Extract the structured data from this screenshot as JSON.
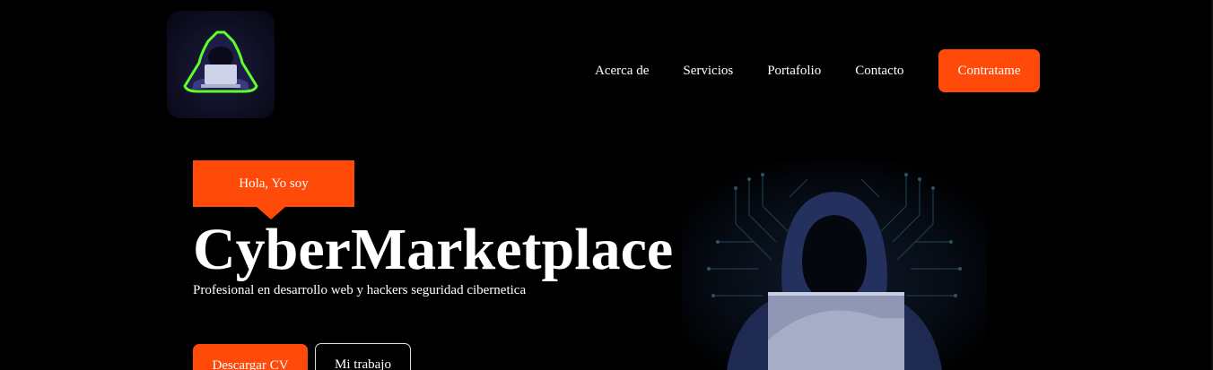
{
  "brand": {
    "logo_icon": "hooded-hacker-laptop-icon"
  },
  "nav": {
    "items": [
      "Acerca de",
      "Servicios",
      "Portafolio",
      "Contacto"
    ],
    "cta_label": "Contratame"
  },
  "hero": {
    "greeting": "Hola, Yo soy",
    "title": "CyberMarketplace",
    "subtitle": "Profesional en desarrollo web y hackers seguridad cibernetica",
    "primary_button": "Descargar CV",
    "secondary_button": "Mi trabajo",
    "illustration_icon": "hooded-hacker-illustration"
  },
  "colors": {
    "accent": "#ff4a0a",
    "background": "#000000",
    "text": "#ffffff"
  }
}
